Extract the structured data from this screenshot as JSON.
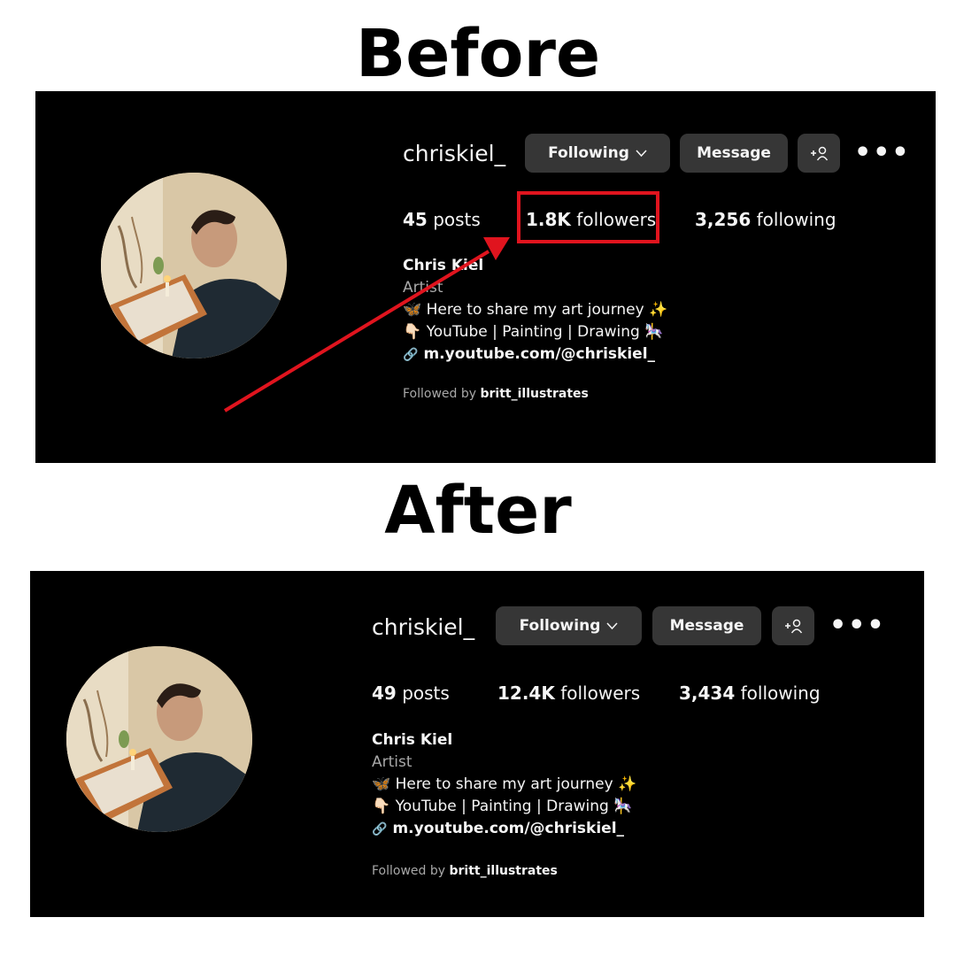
{
  "headings": {
    "before": "Before",
    "after": "After"
  },
  "profile": {
    "username": "chriskiel_",
    "following_button": "Following",
    "message_button": "Message",
    "add_user_icon": "add-user-icon",
    "more_icon": "more-options-icon",
    "display_name": "Chris Kiel",
    "category": "Artist",
    "bio_line1": "🦋 Here to share my art journey ✨",
    "bio_line2": "👇🏻 YouTube | Painting | Drawing 🎠",
    "link": "m.youtube.com/@chriskiel_",
    "followed_by_prefix": "Followed by",
    "followed_by_user": "britt_illustrates"
  },
  "before": {
    "posts_count": "45",
    "posts_label": "posts",
    "followers_count": "1.8K",
    "followers_label": "followers",
    "following_count": "3,256",
    "following_label": "following"
  },
  "after": {
    "posts_count": "49",
    "posts_label": "posts",
    "followers_count": "12.4K",
    "followers_label": "followers",
    "following_count": "3,434",
    "following_label": "following"
  },
  "colors": {
    "background": "#000000",
    "button": "#363636",
    "text": "#f5f5f5",
    "muted": "#a8a8a8",
    "annotation": "#e0141e"
  }
}
